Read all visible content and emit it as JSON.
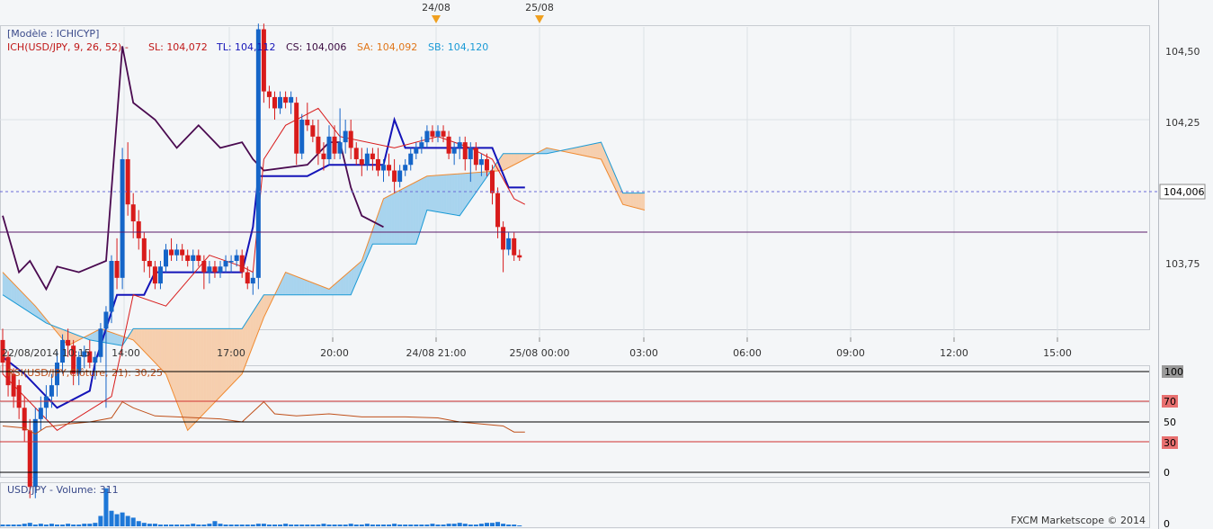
{
  "colors": {
    "background": "#f4f6f8",
    "up": "#1565c8",
    "down": "#d81b1b",
    "tenkan": "#d81b1b",
    "kijun": "#1414b8",
    "chikou": "#4a0a50",
    "spanA": "#f08a30",
    "spanB": "#1a9ad6",
    "cloud_up": "#a8d4ee",
    "cloud_down": "#f6cfae",
    "rsi": "#c0501a",
    "volume": "#1e78d8"
  },
  "header": {
    "model_label": "[Modèle : ICHICYP]",
    "ich_label": "ICH(USD/JPY, 9, 26, 52) -",
    "sl": "SL: 104,072",
    "tl": "TL: 104,112",
    "cs": "CS: 104,006",
    "sa": "SA: 104,092",
    "sb": "SB: 104,120"
  },
  "markers": [
    {
      "label": "24/08",
      "x_label": "24/08 21:00"
    },
    {
      "label": "25/08",
      "x_label": "25/08 00:00"
    }
  ],
  "price_axis": {
    "ticks": [
      "104,50",
      "104,25",
      "103,75"
    ],
    "current_price": "104,006"
  },
  "time_axis": {
    "labels": [
      "22/08/2014 10:15",
      "14:00",
      "17:00",
      "20:00",
      "24/08 21:00",
      "25/08 00:00",
      "03:00",
      "06:00",
      "09:00",
      "12:00",
      "15:00"
    ]
  },
  "rsi_panel": {
    "label": "RSI(USD/JPY,Clôture, 21): 30,25",
    "levels": [
      "100",
      "70",
      "50",
      "30",
      "0"
    ]
  },
  "volume_panel": {
    "label": "USD/JPY - Volume: 311",
    "axis_label": "0",
    "watermark": "FXCM Marketscope © 2014"
  },
  "chart_data": {
    "type": "candlestick",
    "symbol": "USD/JPY",
    "price_ylim": [
      103.55,
      104.55
    ],
    "candles": [
      [
        103.86,
        103.88,
        103.8,
        103.82
      ],
      [
        103.83,
        103.84,
        103.76,
        103.78
      ],
      [
        103.8,
        103.81,
        103.74,
        103.76
      ],
      [
        103.78,
        103.79,
        103.72,
        103.74
      ],
      [
        103.74,
        103.76,
        103.68,
        103.7
      ],
      [
        103.7,
        103.72,
        103.58,
        103.6
      ],
      [
        103.6,
        103.74,
        103.58,
        103.72
      ],
      [
        103.72,
        103.76,
        103.7,
        103.74
      ],
      [
        103.74,
        103.78,
        103.72,
        103.76
      ],
      [
        103.76,
        103.8,
        103.74,
        103.78
      ],
      [
        103.78,
        103.84,
        103.76,
        103.82
      ],
      [
        103.82,
        103.87,
        103.8,
        103.86
      ],
      [
        103.86,
        103.88,
        103.83,
        103.85
      ],
      [
        103.85,
        103.86,
        103.78,
        103.8
      ],
      [
        103.8,
        103.84,
        103.78,
        103.83
      ],
      [
        103.83,
        103.85,
        103.81,
        103.84
      ],
      [
        103.84,
        103.86,
        103.81,
        103.82
      ],
      [
        103.82,
        103.84,
        103.79,
        103.83
      ],
      [
        103.83,
        103.89,
        103.82,
        103.88
      ],
      [
        103.88,
        103.92,
        103.74,
        103.91
      ],
      [
        103.91,
        104.01,
        103.89,
        104.0
      ],
      [
        104.0,
        104.04,
        103.95,
        103.97
      ],
      [
        103.97,
        104.2,
        103.95,
        104.18
      ],
      [
        104.18,
        104.21,
        104.08,
        104.1
      ],
      [
        104.1,
        104.12,
        104.04,
        104.07
      ],
      [
        104.07,
        104.09,
        104.02,
        104.04
      ],
      [
        104.04,
        104.05,
        103.98,
        104.0
      ],
      [
        104.0,
        104.02,
        103.97,
        103.99
      ],
      [
        103.99,
        104.0,
        103.95,
        103.96
      ],
      [
        103.96,
        104.0,
        103.95,
        103.99
      ],
      [
        103.99,
        104.03,
        103.98,
        104.02
      ],
      [
        104.02,
        104.04,
        104.0,
        104.01
      ],
      [
        104.01,
        104.03,
        104.0,
        104.02
      ],
      [
        104.02,
        104.03,
        104.0,
        104.01
      ],
      [
        104.01,
        104.02,
        103.99,
        104.0
      ],
      [
        104.0,
        104.02,
        103.98,
        104.01
      ],
      [
        104.01,
        104.02,
        103.99,
        104.0
      ],
      [
        104.0,
        104.01,
        103.95,
        103.98
      ],
      [
        103.98,
        104.0,
        103.96,
        103.99
      ],
      [
        103.99,
        104.0,
        103.97,
        103.98
      ],
      [
        103.98,
        104.0,
        103.97,
        103.99
      ],
      [
        103.99,
        104.01,
        103.98,
        104.0
      ],
      [
        104.0,
        104.01,
        103.98,
        104.0
      ],
      [
        104.0,
        104.02,
        103.99,
        104.01
      ],
      [
        104.01,
        104.02,
        103.97,
        103.98
      ],
      [
        103.98,
        103.99,
        103.95,
        103.96
      ],
      [
        103.96,
        103.98,
        103.94,
        103.97
      ],
      [
        103.97,
        104.42,
        103.95,
        104.41
      ],
      [
        104.41,
        104.42,
        104.28,
        104.3
      ],
      [
        104.3,
        104.31,
        104.27,
        104.29
      ],
      [
        104.29,
        104.3,
        104.25,
        104.27
      ],
      [
        104.27,
        104.3,
        104.26,
        104.29
      ],
      [
        104.29,
        104.3,
        104.27,
        104.28
      ],
      [
        104.28,
        104.3,
        104.26,
        104.29
      ],
      [
        104.28,
        104.29,
        104.17,
        104.19
      ],
      [
        104.19,
        104.26,
        104.18,
        104.25
      ],
      [
        104.25,
        104.28,
        104.23,
        104.24
      ],
      [
        104.24,
        104.25,
        104.21,
        104.22
      ],
      [
        104.22,
        104.25,
        104.17,
        104.19
      ],
      [
        104.19,
        104.21,
        104.16,
        104.18
      ],
      [
        104.18,
        104.24,
        104.17,
        104.22
      ],
      [
        104.22,
        104.24,
        104.18,
        104.19
      ],
      [
        104.19,
        104.27,
        104.18,
        104.21
      ],
      [
        104.21,
        104.25,
        104.19,
        104.23
      ],
      [
        104.23,
        104.25,
        104.18,
        104.2
      ],
      [
        104.2,
        104.21,
        104.17,
        104.18
      ],
      [
        104.18,
        104.2,
        104.15,
        104.17
      ],
      [
        104.17,
        104.2,
        104.16,
        104.19
      ],
      [
        104.19,
        104.2,
        104.16,
        104.18
      ],
      [
        104.18,
        104.2,
        104.15,
        104.16
      ],
      [
        104.16,
        104.18,
        104.14,
        104.17
      ],
      [
        104.17,
        104.19,
        104.15,
        104.16
      ],
      [
        104.16,
        104.18,
        104.12,
        104.14
      ],
      [
        104.14,
        104.17,
        104.13,
        104.16
      ],
      [
        104.16,
        104.18,
        104.15,
        104.17
      ],
      [
        104.17,
        104.2,
        104.16,
        104.19
      ],
      [
        104.19,
        104.21,
        104.18,
        104.2
      ],
      [
        104.2,
        104.22,
        104.19,
        104.21
      ],
      [
        104.21,
        104.24,
        104.2,
        104.23
      ],
      [
        104.23,
        104.24,
        104.21,
        104.22
      ],
      [
        104.22,
        104.24,
        104.21,
        104.23
      ],
      [
        104.23,
        104.24,
        104.21,
        104.22
      ],
      [
        104.22,
        104.23,
        104.18,
        104.19
      ],
      [
        104.19,
        104.21,
        104.17,
        104.2
      ],
      [
        104.2,
        104.22,
        104.18,
        104.21
      ],
      [
        104.21,
        104.22,
        104.16,
        104.18
      ],
      [
        104.18,
        104.21,
        104.14,
        104.2
      ],
      [
        104.2,
        104.21,
        104.16,
        104.17
      ],
      [
        104.17,
        104.19,
        104.15,
        104.18
      ],
      [
        104.18,
        104.19,
        104.15,
        104.16
      ],
      [
        104.16,
        104.17,
        104.1,
        104.12
      ],
      [
        104.12,
        104.13,
        104.04,
        104.06
      ],
      [
        104.06,
        104.07,
        103.98,
        104.02
      ],
      [
        104.02,
        104.05,
        104.01,
        104.04
      ],
      [
        104.04,
        104.05,
        104.0,
        104.01
      ],
      [
        104.01,
        104.02,
        104.0,
        104.006
      ]
    ],
    "tenkan": [
      [
        0,
        103.8
      ],
      [
        10,
        103.7
      ],
      [
        20,
        103.76
      ],
      [
        24,
        103.94
      ],
      [
        30,
        103.92
      ],
      [
        38,
        104.01
      ],
      [
        44,
        103.99
      ],
      [
        46,
        103.98
      ],
      [
        48,
        104.18
      ],
      [
        52,
        104.24
      ],
      [
        58,
        104.27
      ],
      [
        62,
        104.22
      ],
      [
        72,
        104.2
      ],
      [
        80,
        104.22
      ],
      [
        86,
        104.2
      ],
      [
        90,
        104.18
      ],
      [
        94,
        104.11
      ],
      [
        96,
        104.1
      ]
    ],
    "kijun": [
      [
        0,
        103.83
      ],
      [
        4,
        103.8
      ],
      [
        10,
        103.74
      ],
      [
        16,
        103.77
      ],
      [
        17,
        103.82
      ],
      [
        21,
        103.94
      ],
      [
        26,
        103.94
      ],
      [
        28,
        103.98
      ],
      [
        44,
        103.98
      ],
      [
        46,
        104.06
      ],
      [
        47,
        104.15
      ],
      [
        56,
        104.15
      ],
      [
        60,
        104.17
      ],
      [
        70,
        104.17
      ],
      [
        72,
        104.25
      ],
      [
        74,
        104.2
      ],
      [
        90,
        104.2
      ],
      [
        93,
        104.13
      ],
      [
        96,
        104.13
      ]
    ],
    "chikou": [
      [
        0,
        104.08
      ],
      [
        3,
        103.98
      ],
      [
        5,
        104.0
      ],
      [
        8,
        103.95
      ],
      [
        10,
        103.99
      ],
      [
        14,
        103.98
      ],
      [
        19,
        104.0
      ],
      [
        22,
        104.38
      ],
      [
        24,
        104.28
      ],
      [
        28,
        104.25
      ],
      [
        32,
        104.2
      ],
      [
        36,
        104.24
      ],
      [
        40,
        104.2
      ],
      [
        44,
        104.21
      ],
      [
        46,
        104.18
      ],
      [
        48,
        104.16
      ],
      [
        56,
        104.17
      ],
      [
        60,
        104.21
      ],
      [
        62,
        104.21
      ],
      [
        64,
        104.13
      ],
      [
        66,
        104.08
      ],
      [
        70,
        104.06
      ]
    ],
    "span_a": [
      [
        0,
        103.98
      ],
      [
        6,
        103.92
      ],
      [
        12,
        103.85
      ],
      [
        18,
        103.88
      ],
      [
        24,
        103.86
      ],
      [
        30,
        103.8
      ],
      [
        34,
        103.7
      ],
      [
        38,
        103.74
      ],
      [
        44,
        103.8
      ],
      [
        48,
        103.9
      ],
      [
        52,
        103.98
      ],
      [
        60,
        103.95
      ],
      [
        66,
        104.0
      ],
      [
        70,
        104.11
      ],
      [
        78,
        104.15
      ],
      [
        92,
        104.16
      ],
      [
        100,
        104.2
      ],
      [
        110,
        104.18
      ],
      [
        114,
        104.1
      ],
      [
        118,
        104.09
      ]
    ],
    "span_b": [
      [
        0,
        103.94
      ],
      [
        8,
        103.89
      ],
      [
        16,
        103.86
      ],
      [
        22,
        103.85
      ],
      [
        24,
        103.88
      ],
      [
        44,
        103.88
      ],
      [
        48,
        103.94
      ],
      [
        64,
        103.94
      ],
      [
        68,
        104.03
      ],
      [
        76,
        104.03
      ],
      [
        78,
        104.09
      ],
      [
        84,
        104.08
      ],
      [
        92,
        104.19
      ],
      [
        100,
        104.19
      ],
      [
        110,
        104.21
      ],
      [
        114,
        104.12
      ],
      [
        118,
        104.12
      ]
    ],
    "rsi_series": [
      [
        0,
        46
      ],
      [
        4,
        44
      ],
      [
        6,
        38
      ],
      [
        8,
        45
      ],
      [
        12,
        48
      ],
      [
        16,
        50
      ],
      [
        20,
        54
      ],
      [
        22,
        70
      ],
      [
        24,
        64
      ],
      [
        28,
        56
      ],
      [
        36,
        54
      ],
      [
        40,
        53
      ],
      [
        44,
        50
      ],
      [
        48,
        70
      ],
      [
        50,
        58
      ],
      [
        54,
        56
      ],
      [
        60,
        58
      ],
      [
        66,
        55
      ],
      [
        74,
        55
      ],
      [
        80,
        54
      ],
      [
        84,
        50
      ],
      [
        88,
        48
      ],
      [
        92,
        46
      ],
      [
        94,
        40
      ],
      [
        96,
        40
      ]
    ],
    "volume": [
      2,
      2,
      2,
      2,
      3,
      4,
      2,
      3,
      2,
      3,
      2,
      2,
      3,
      2,
      2,
      3,
      3,
      4,
      12,
      44,
      18,
      14,
      16,
      12,
      10,
      6,
      4,
      3,
      3,
      2,
      2,
      2,
      2,
      2,
      2,
      3,
      2,
      2,
      3,
      6,
      3,
      2,
      2,
      2,
      2,
      2,
      2,
      3,
      3,
      2,
      2,
      2,
      3,
      2,
      2,
      2,
      2,
      2,
      2,
      3,
      2,
      2,
      2,
      2,
      3,
      2,
      2,
      3,
      2,
      2,
      2,
      2,
      3,
      2,
      2,
      2,
      2,
      2,
      2,
      3,
      2,
      2,
      3,
      3,
      4,
      3,
      2,
      2,
      3,
      4,
      4,
      5,
      3,
      2,
      2,
      1
    ],
    "volume_ylim": [
      0,
      50
    ]
  }
}
